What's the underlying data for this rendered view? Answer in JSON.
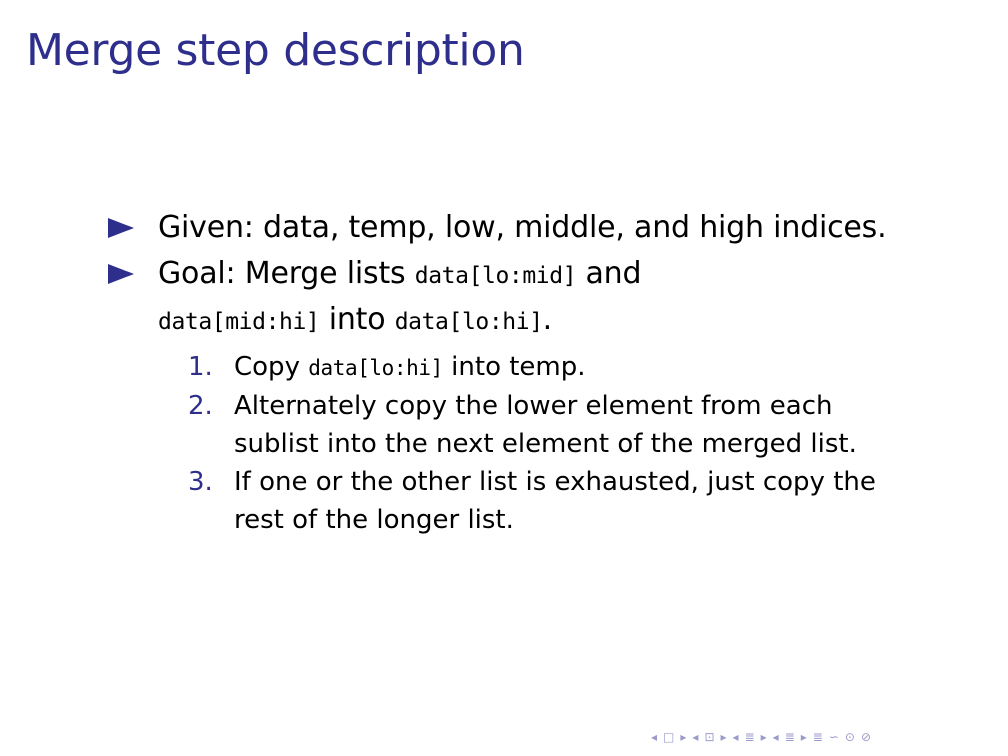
{
  "title": "Merge step description",
  "bullets": [
    {
      "text": "Given: data, temp, low, middle, and high indices."
    },
    {
      "parts": [
        "Goal: Merge lists ",
        "data[lo:mid]",
        " and ",
        "data[mid:hi]",
        " into ",
        "data[lo:hi]",
        "."
      ],
      "steps": [
        {
          "num": "1.",
          "parts": [
            "Copy ",
            "data[lo:hi]",
            " into temp."
          ]
        },
        {
          "num": "2.",
          "text": "Alternately copy the lower element from each sublist into the next element of the merged list."
        },
        {
          "num": "3.",
          "text": "If one or the other list is exhausted, just copy the rest of the longer list."
        }
      ]
    }
  ],
  "nav": {
    "symbols": [
      "◂",
      "□",
      "▸",
      "◂",
      "⊡",
      "▸",
      "◂",
      "≣",
      "▸",
      "◂",
      "≣",
      "▸",
      "≣",
      "∽",
      "⊙",
      "⊘"
    ]
  },
  "colors": {
    "accent": "#2e2e8c",
    "nav": "#9a9acb"
  }
}
